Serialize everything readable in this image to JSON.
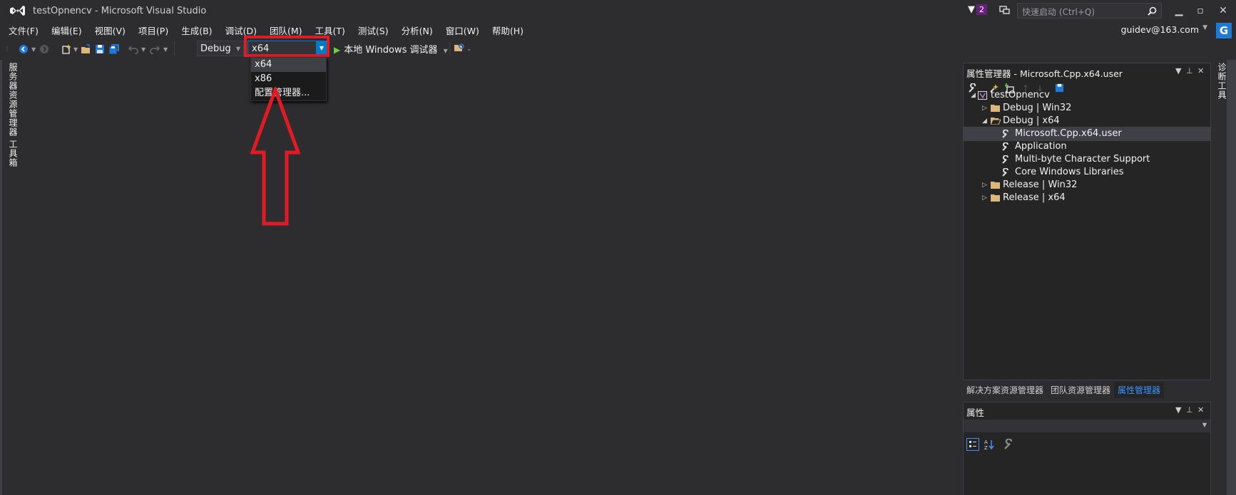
{
  "window": {
    "title": "testOpnencv - Microsoft Visual Studio",
    "notification_count": "2",
    "quick_launch_placeholder": "快速启动 (Ctrl+Q)"
  },
  "menu": [
    "文件(F)",
    "编辑(E)",
    "视图(V)",
    "项目(P)",
    "生成(B)",
    "调试(D)",
    "团队(M)",
    "工具(T)",
    "测试(S)",
    "分析(N)",
    "窗口(W)",
    "帮助(H)"
  ],
  "user": {
    "email": "guidev@163.com",
    "avatar_letter": "G"
  },
  "toolbar": {
    "configuration": "Debug",
    "platform": "x64",
    "start_label": "本地 Windows 调试器"
  },
  "platform_dropdown": {
    "options": [
      "x64",
      "x86",
      "配置管理器..."
    ],
    "selected_index": 0
  },
  "left_tool_tabs": [
    "服务器资源管理器",
    "工具箱"
  ],
  "property_manager": {
    "title": "属性管理器 - Microsoft.Cpp.x64.user",
    "tree": [
      {
        "label": "testOpnencv",
        "level": 0,
        "icon": "project-icon",
        "expanded": true
      },
      {
        "label": "Debug | Win32",
        "level": 1,
        "icon": "folder-icon",
        "expanded": false
      },
      {
        "label": "Debug | x64",
        "level": 1,
        "icon": "folder-open-icon",
        "expanded": true
      },
      {
        "label": "Microsoft.Cpp.x64.user",
        "level": 2,
        "icon": "property-sheet-icon",
        "selected": true
      },
      {
        "label": "Application",
        "level": 2,
        "icon": "property-sheet-icon"
      },
      {
        "label": "Multi-byte Character Support",
        "level": 2,
        "icon": "property-sheet-icon"
      },
      {
        "label": "Core Windows Libraries",
        "level": 2,
        "icon": "property-sheet-icon"
      },
      {
        "label": "Release | Win32",
        "level": 1,
        "icon": "folder-icon",
        "expanded": false
      },
      {
        "label": "Release | x64",
        "level": 1,
        "icon": "folder-icon",
        "expanded": false
      }
    ]
  },
  "bottom_tabs": [
    {
      "label": "解决方案资源管理器",
      "active": false
    },
    {
      "label": "团队资源管理器",
      "active": false
    },
    {
      "label": "属性管理器",
      "active": true
    }
  ],
  "properties_panel": {
    "title": "属性"
  },
  "right_tool_tabs": [
    "诊断工具"
  ],
  "colors": {
    "accent": "#007acc",
    "highlight": "#e01b24",
    "background": "#2d2d30",
    "panel": "#252526"
  }
}
